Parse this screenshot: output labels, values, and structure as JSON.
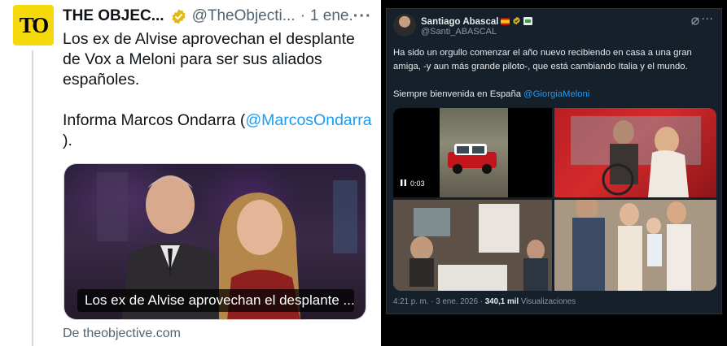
{
  "left_tweet": {
    "avatar_text": "TO",
    "display_name": "THE OBJEC...",
    "handle": "@TheObjecti...",
    "separator": "·",
    "date": "1 ene.",
    "more_label": "···",
    "body_line1": "Los ex de Alvise aprovechan el desplante de Vox a Meloni para ser sus aliados españoles.",
    "body_prefix": "Informa Marcos Ondarra (",
    "body_mention": "@MarcosOndarra",
    "body_suffix": ").",
    "card_title": "Los ex de Alvise aprovechan el desplante ...",
    "card_source": "De theobjective.com",
    "accent_color": "#1d9bf0",
    "verified_color": "#e2b719"
  },
  "right_tweet": {
    "display_name": "Santiago Abascal",
    "handle": "@Santi_ABASCAL",
    "more_label": "···",
    "body_paragraph1": "Ha sido un orgullo comenzar el año nuevo recibiendo en casa a una gran amiga, -y aun más grande piloto-, que está cambiando Italia y el mundo.",
    "body_prefix2": "Siempre bienvenida en España ",
    "body_mention2": "@GiorgiaMeloni",
    "video_time": "0:03",
    "timestamp": "4:21 p. m. · 3 ene. 2026 · ",
    "views_count": "340,1 mil",
    "views_label": " Visualizaciones",
    "background_color": "#15202b"
  }
}
